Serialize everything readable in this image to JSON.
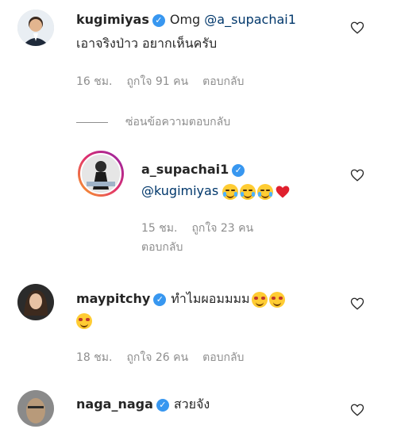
{
  "comments": [
    {
      "username": "kugimiyas",
      "text_prefix": "Omg ",
      "mention": "@a_supachai1",
      "text_line2": "เอาจริงป่าว อยากเห็นครับ",
      "time": "16 ชม.",
      "likes": "ถูกใจ 91 คน",
      "reply_label": "ตอบกลับ",
      "hide_replies_label": "ซ่อนข้อความตอบกลับ"
    }
  ],
  "reply": {
    "username": "a_supachai1",
    "mention": "@kugimiyas",
    "time": "15 ชม.",
    "likes": "ถูกใจ 23 คน",
    "reply_label": "ตอบกลับ"
  },
  "comment2": {
    "username": "maypitchy",
    "text": "ทำไมผอมมมม",
    "time": "18 ชม.",
    "likes": "ถูกใจ 26 คน",
    "reply_label": "ตอบกลับ"
  },
  "comment3": {
    "username": "naga_naga",
    "text": "สวยจัง"
  },
  "icons": {
    "verified": "verified-badge-icon",
    "like": "heart-outline-icon"
  },
  "colors": {
    "verified": "#3897f0",
    "mention": "#00376b",
    "meta": "#8e8e8e",
    "story_ring": "#e1306c"
  }
}
